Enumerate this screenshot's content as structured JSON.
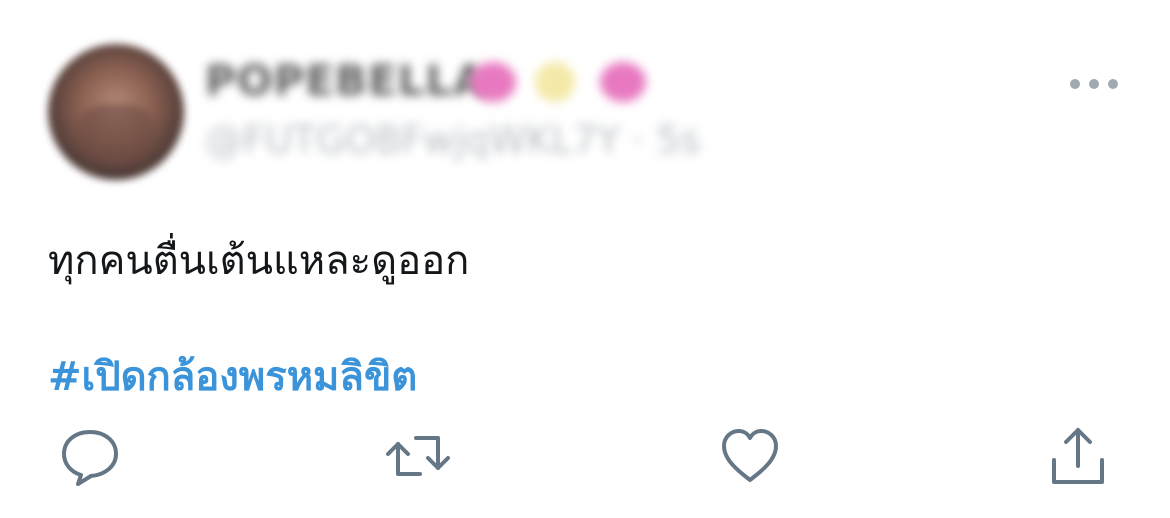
{
  "tweet": {
    "display_name": "POPEBELLA",
    "handle": "@FUTGOBFwjqWKL7Y · 5s",
    "text": "ทุกคนตื่นเต้นแหละดูออก",
    "hashtag": "#เปิดกล้องพรหมลิขิต"
  },
  "icons": {
    "more": "more-horizontal-icon",
    "reply": "reply-icon",
    "retweet": "retweet-icon",
    "like": "heart-icon",
    "share": "share-icon"
  },
  "colors": {
    "hashtag": "#3b94d9",
    "text": "#14171a",
    "icon": "#657786",
    "muted": "#a0a8b0"
  }
}
